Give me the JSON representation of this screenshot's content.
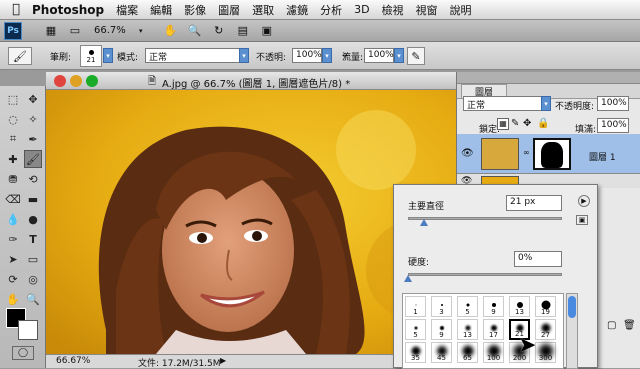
{
  "menubar": {
    "app": "Photoshop",
    "items": [
      "檔案",
      "編輯",
      "影像",
      "圖層",
      "選取",
      "濾鏡",
      "分析",
      "3D",
      "檢視",
      "視窗",
      "說明"
    ]
  },
  "appbar": {
    "logo": "Ps",
    "zoom": "66.7%"
  },
  "options": {
    "brush_label": "筆刷:",
    "brush_size": "21",
    "mode_label": "模式:",
    "mode_value": "正常",
    "opacity_label": "不透明:",
    "opacity_value": "100%",
    "flow_label": "流量:",
    "flow_value": "100%"
  },
  "document": {
    "title": "A.jpg @ 66.7% (圖層 1, 圖層遮色片/8) *",
    "zoom": "66.67%",
    "file_info": "文件: 17.2M/31.5M"
  },
  "layers": {
    "panel_title": "圖層",
    "blend_mode": "正常",
    "opacity_label": "不透明度:",
    "opacity_value": "100%",
    "lock_label": "鎖定:",
    "fill_label": "填滿:",
    "fill_value": "100%",
    "layer1_name": "圖層 1"
  },
  "brush_picker": {
    "diameter_label": "主要直徑",
    "diameter_value": "21 px",
    "hardness_label": "硬度:",
    "hardness_value": "0%",
    "presets": [
      {
        "label": "1"
      },
      {
        "label": "3"
      },
      {
        "label": "5"
      },
      {
        "label": "9"
      },
      {
        "label": "13"
      },
      {
        "label": "19"
      },
      {
        "label": "5"
      },
      {
        "label": "9"
      },
      {
        "label": "13"
      },
      {
        "label": "17"
      },
      {
        "label": "21"
      },
      {
        "label": "27"
      },
      {
        "label": "35"
      },
      {
        "label": "45"
      },
      {
        "label": "65"
      },
      {
        "label": "100"
      },
      {
        "label": "200"
      },
      {
        "label": "300"
      }
    ]
  },
  "colors": {
    "accent": "#3a78d8",
    "canvas_bg": "#e8b818"
  }
}
